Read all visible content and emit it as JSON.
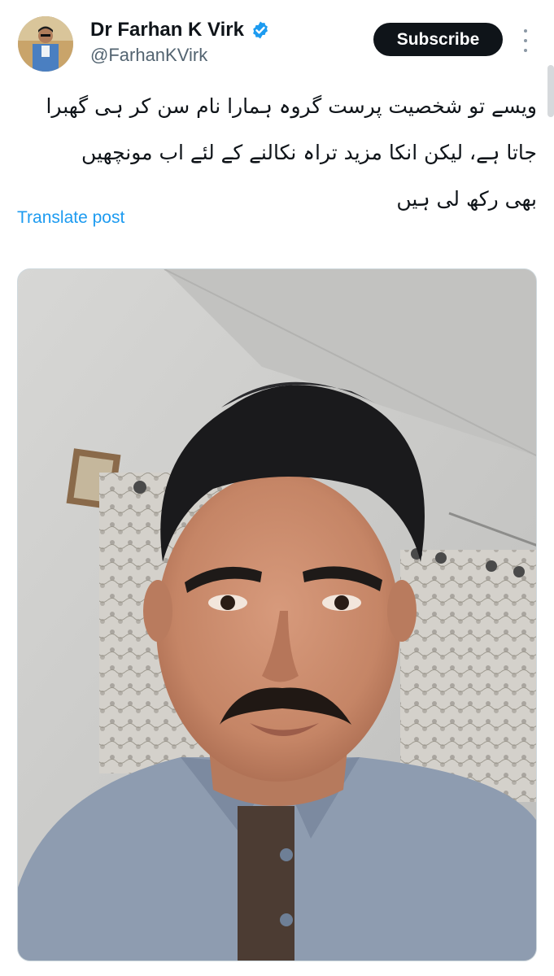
{
  "author": {
    "name": "Dr Farhan K Virk",
    "handle": "@FarhanKVirk",
    "verified": true,
    "verified_color": "#1d9bf0"
  },
  "actions": {
    "subscribe_label": "Subscribe"
  },
  "post": {
    "lines": [
      "ویسے تو شخصیت پرست گروہ ہمارا نام سن کر ہی گھبرا",
      "جاتا ہے، لیکن انکا مزید تراہ نکالنے کے لئے اب مونچھیں",
      "بھی رکھ لی ہیں"
    ],
    "translate_label": "Translate post"
  },
  "colors": {
    "accent": "#1d9bf0",
    "button_bg": "#0f1419",
    "secondary_text": "#536471"
  }
}
